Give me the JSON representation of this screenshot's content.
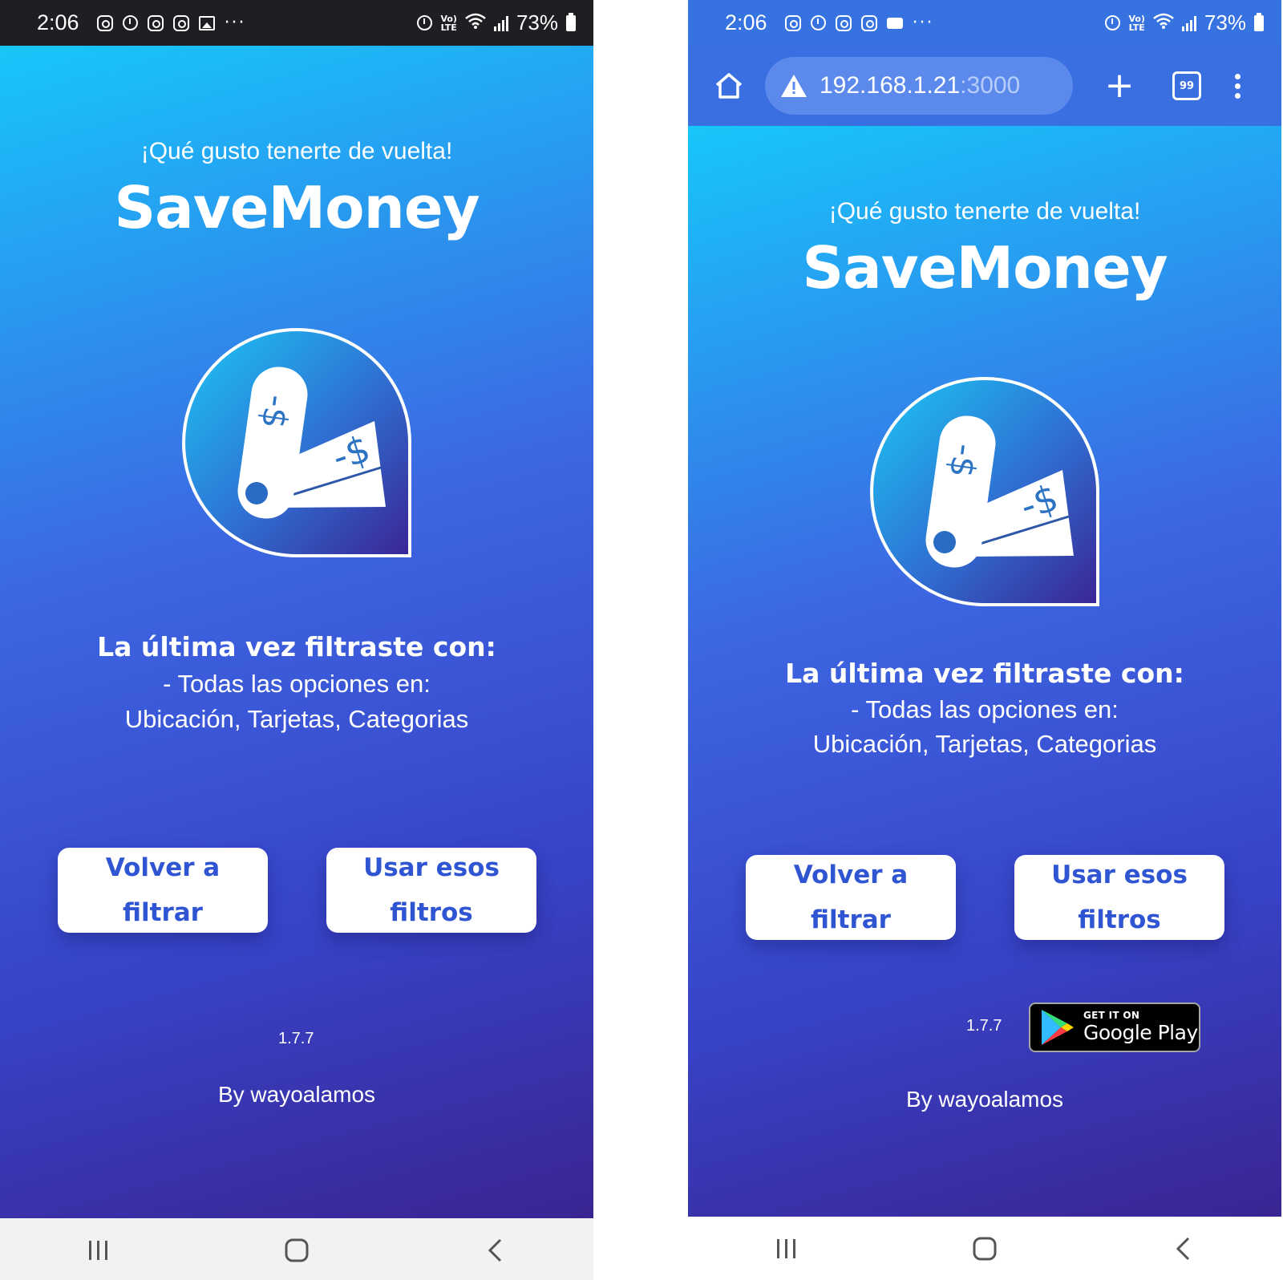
{
  "status_bar": {
    "time": "2:06",
    "battery": "73%",
    "lte": "Vo)\nLTE"
  },
  "browser": {
    "url_host": "192.168.1.21",
    "url_port": ":3000",
    "tab_count": "99",
    "new_tab_symbol": "+"
  },
  "app": {
    "greeting": "¡Qué gusto tenerte de vuelta!",
    "brand": "SaveMoney",
    "last_filter_title": "La última vez filtraste con:",
    "last_filter_line1": "- Todas las opciones en:",
    "last_filter_line2": "Ubicación, Tarjetas, Categorias",
    "refilter_button": "Volver a filtrar",
    "use_filters_button": "Usar esos filtros",
    "version": "1.7.7",
    "byline": "By wayoalamos",
    "google_play_small": "GET IT ON",
    "google_play_big": "Google Play"
  },
  "colors": {
    "gradient_start": "#17c6fb",
    "gradient_mid": "#3d66e2",
    "gradient_end": "#3a2493",
    "button_text": "#2f55d2",
    "status_bar_dark": "#1e1f22",
    "browser_bar": "#3a6fe2"
  },
  "icons": [
    "instagram-icon",
    "alarm-icon",
    "gallery-icon",
    "video-icon",
    "wifi-icon",
    "signal-icon",
    "battery-icon",
    "home-icon",
    "warning-icon",
    "menu-dots-icon",
    "recent-apps-icon",
    "home-nav-icon",
    "back-icon"
  ]
}
